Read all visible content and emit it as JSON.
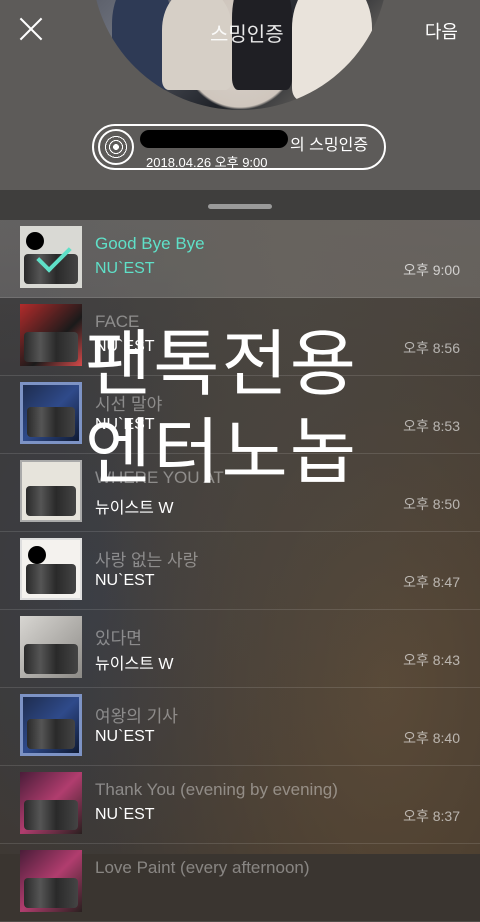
{
  "header": {
    "album_title": "스밍인증",
    "next_label": "다음"
  },
  "now_playing_pill": {
    "title_suffix": "의 스밍인증",
    "date": "2018.04.26 오후 9:00"
  },
  "songs": [
    {
      "title": "Good Bye Bye",
      "artist": "NU`EST",
      "time": "오후 9:00",
      "selected": true
    },
    {
      "title": "FACE",
      "artist": "NU`EST",
      "time": "오후 8:56"
    },
    {
      "title": "시선 말야",
      "artist": "NU`EST",
      "time": "오후 8:53"
    },
    {
      "title": "WHERE YOU AT",
      "artist": "뉴이스트 W",
      "time": "오후 8:50"
    },
    {
      "title": "사랑 없는 사랑",
      "artist": "NU`EST",
      "time": "오후 8:47"
    },
    {
      "title": "있다면",
      "artist": "뉴이스트 W",
      "time": "오후 8:43"
    },
    {
      "title": "여왕의 기사",
      "artist": "NU`EST",
      "time": "오후 8:40"
    },
    {
      "title": "Thank You (evening by evening)",
      "artist": "NU`EST",
      "time": "오후 8:37"
    },
    {
      "title": "Love Paint (every afternoon)",
      "artist": "",
      "time": ""
    }
  ],
  "watermark": {
    "line1": "팬톡전용",
    "line2": "엔터노놉"
  },
  "colors": {
    "accent": "#5fe0c8"
  }
}
